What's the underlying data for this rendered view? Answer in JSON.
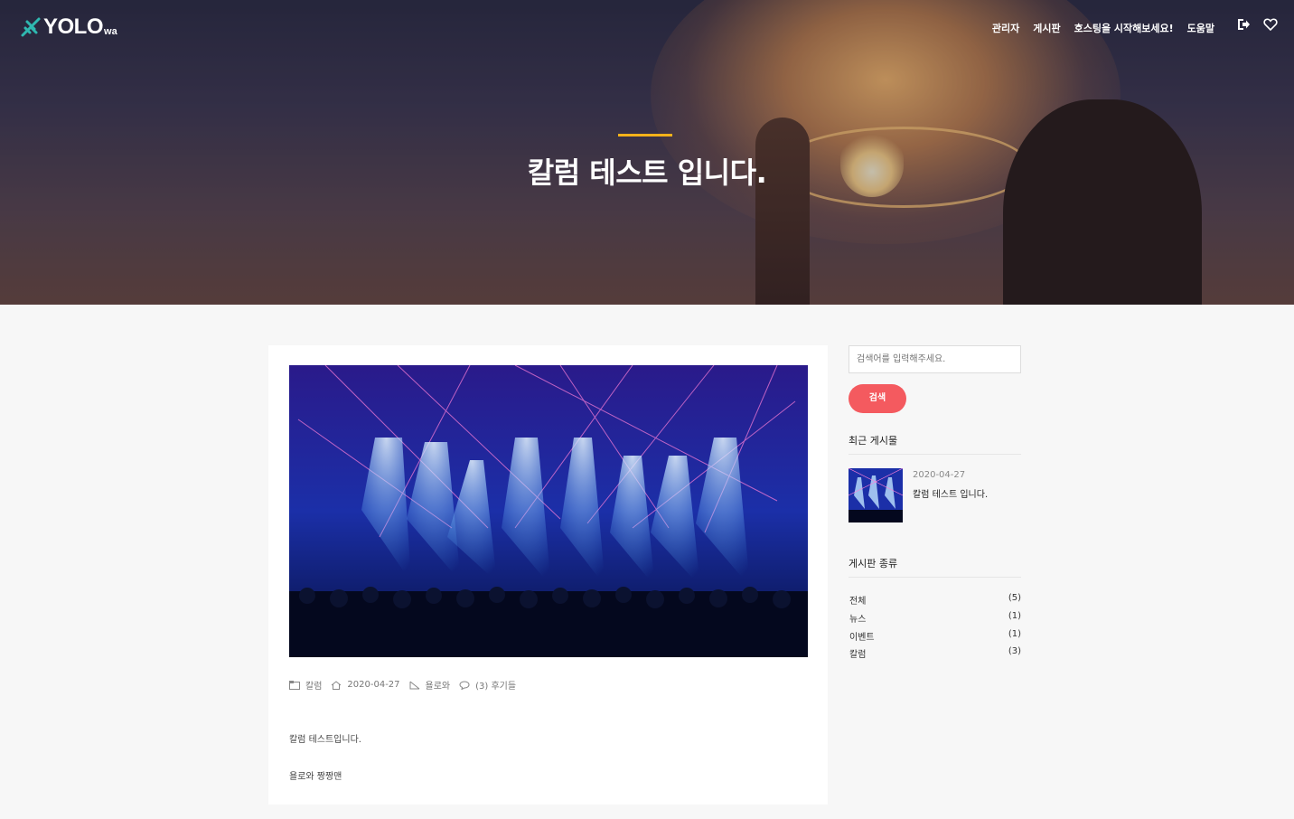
{
  "header": {
    "logo_text": "YOLO",
    "logo_sub": "wa",
    "nav": [
      "관리자",
      "게시판",
      "호스팅을 시작해보세요!",
      "도움말"
    ],
    "icons": [
      "logout-icon",
      "heart-icon"
    ]
  },
  "hero": {
    "title": "칼럼 테스트 입니다.",
    "accent_color": "#f5b21a"
  },
  "post": {
    "meta": {
      "category": "칼럼",
      "date": "2020-04-27",
      "author": "욜로와",
      "comments": "(3) 후기들"
    },
    "paragraphs": [
      "칼럼 테스트입니다.",
      "욜로와 짱짱맨"
    ]
  },
  "sidebar": {
    "search_placeholder": "검색어를 입력해주세요.",
    "search_button": "검색",
    "search_button_color": "#f45a5f",
    "recent_heading": "최근 게시물",
    "recent": [
      {
        "date": "2020-04-27",
        "title": "칼럼 테스트 입니다."
      }
    ],
    "categories_heading": "게시판 종류",
    "categories": [
      {
        "name": "전체",
        "count": "(5)"
      },
      {
        "name": "뉴스",
        "count": "(1)"
      },
      {
        "name": "이벤트",
        "count": "(1)"
      },
      {
        "name": "칼럼",
        "count": "(3)"
      }
    ]
  }
}
